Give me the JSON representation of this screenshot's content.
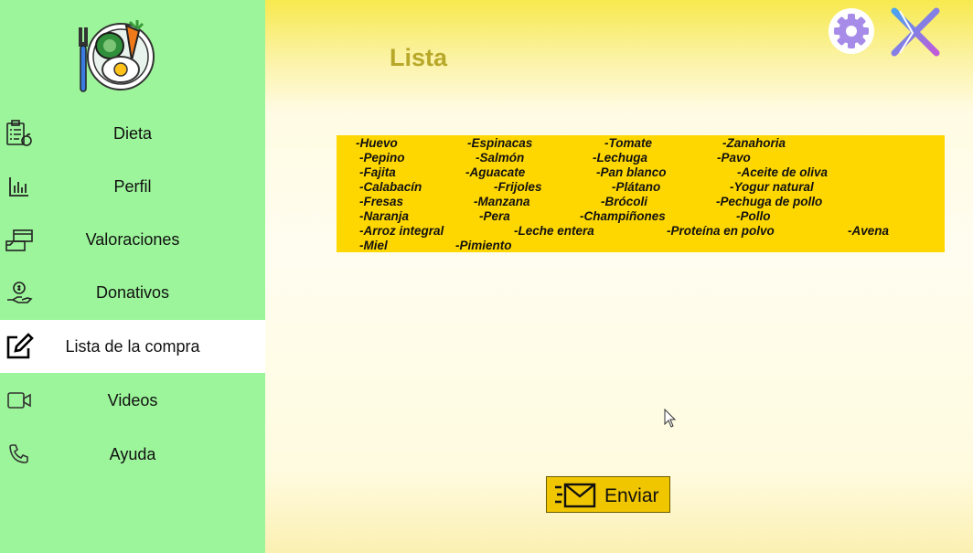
{
  "nav": [
    {
      "label": "Dieta",
      "icon": "diet-clipboard-icon"
    },
    {
      "label": "Perfil",
      "icon": "bar-chart-icon"
    },
    {
      "label": "Valoraciones",
      "icon": "rating-box-icon"
    },
    {
      "label": "Donativos",
      "icon": "donation-hand-icon"
    },
    {
      "label": "Lista de la compra",
      "icon": "edit-note-icon",
      "active": true
    },
    {
      "label": "Videos",
      "icon": "video-camera-icon"
    },
    {
      "label": "Ayuda",
      "icon": "phone-icon"
    }
  ],
  "header": {
    "title": "Lista"
  },
  "list": {
    "items": [
      "-Huevo",
      "-Espinacas",
      "-Tomate",
      "-Zanahoria",
      "-Pepino",
      "-Salmón",
      "-Lechuga",
      "-Pavo",
      "-Fajita",
      "-Aguacate",
      "-Pan blanco",
      "-Aceite de oliva",
      "-Calabacín",
      "-Frijoles",
      "-Plátano",
      "-Yogur natural",
      "-Fresas",
      "-Manzana",
      "-Brócoli",
      "-Pechuga de pollo",
      "-Naranja",
      "-Pera",
      "-Champiñones",
      "-Pollo",
      "-Arroz integral",
      "-Leche entera",
      "-Proteína en polvo",
      "-Avena",
      "-Miel",
      "-Pimiento"
    ]
  },
  "actions": {
    "send_label": "Enviar"
  },
  "colors": {
    "sidebar": "#9cf59a",
    "list_bg": "#ffd700",
    "title": "#b8a82a",
    "button": "#f0c600"
  }
}
